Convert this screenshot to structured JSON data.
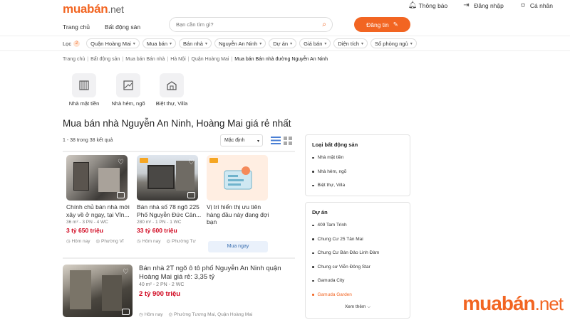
{
  "header": {
    "logo": "muabán",
    "logo_suffix": ".net",
    "links": [
      {
        "label": "Thông báo",
        "icon": "bell-icon"
      },
      {
        "label": "Đăng nhập",
        "icon": "login-icon"
      },
      {
        "label": "Cá nhân",
        "icon": "user-icon"
      }
    ],
    "nav": [
      "Trang chủ",
      "Bất động sản"
    ],
    "search_placeholder": "Bạn cần tìm gì?",
    "post_button": "Đăng tin"
  },
  "filters": {
    "label": "Lọc",
    "count": "2",
    "chips": [
      "Quận Hoàng Mai",
      "Mua bán",
      "Bán nhà",
      "Nguyễn An Ninh",
      "Dự án",
      "Giá bán",
      "Diện tích",
      "Số phòng ngủ"
    ]
  },
  "breadcrumb": [
    "Trang chủ",
    "Bất động sản",
    "Mua bán Bán nhà",
    "Hà Nội",
    "Quận Hoàng Mai",
    "Mua bán Bán nhà đường Nguyễn An Ninh"
  ],
  "categories": [
    "Nhà mặt tiền",
    "Nhà hẻm, ngõ",
    "Biệt thự, Villa"
  ],
  "main": {
    "title": "Mua bán nhà Nguyễn An Ninh, Hoàng Mai giá rẻ nhất",
    "result_count": "1 - 38 trong 38 kết quả",
    "sort_value": "Mặc định"
  },
  "cards": [
    {
      "title": "Chính chủ bán nhà mới xây về ở ngay, tại Vĩn...",
      "meta": "36 m² - 3 PN - 4 WC",
      "price": "3 tỷ 650 triệu",
      "date": "Hôm nay",
      "location": "Phường Vĩ"
    },
    {
      "title": "Bán nhà số 78 ngõ 225 Phố Nguyễn Đức Cản...",
      "meta": "280 m² - 1 PN - 1 WC",
      "price": "33 tỷ 600 triệu",
      "date": "Hôm nay",
      "location": "Phường Tư"
    },
    {
      "title": "Vị trí hiển thị ưu tiên hàng đầu này đang đợi bạn",
      "button": "Mua ngay"
    }
  ],
  "listing": {
    "title": "Bán nhà 2T ngõ ô tô phố Nguyễn An Ninh quận Hoàng Mai giá rẻ: 3,35 tỷ",
    "meta": "40 m² - 2 PN - 2 WC",
    "price": "2 tỷ 900 triệu",
    "date": "Hôm nay",
    "location": "Phường Tương Mai, Quận Hoàng Mai"
  },
  "sidebar": {
    "types": {
      "heading": "Loại bất động sản",
      "items": [
        "Nhà mặt tiền",
        "Nhà hẻm, ngõ",
        "Biệt thự, Villa"
      ]
    },
    "projects": {
      "heading": "Dự án",
      "items": [
        "409 Tam Trinh",
        "Chung Cư 25 Tân Mai",
        "Chung Cư Bán Đảo Linh Đàm",
        "Chung cư Viễn Đông Star",
        "Gamuda City",
        "Gamuda Garden"
      ],
      "highlighted_index": 5,
      "more": "Xem thêm"
    }
  },
  "watermark": {
    "brand": "muabán",
    "suffix": ".net"
  },
  "colors": {
    "accent": "#f26522",
    "price": "#d0021b"
  }
}
